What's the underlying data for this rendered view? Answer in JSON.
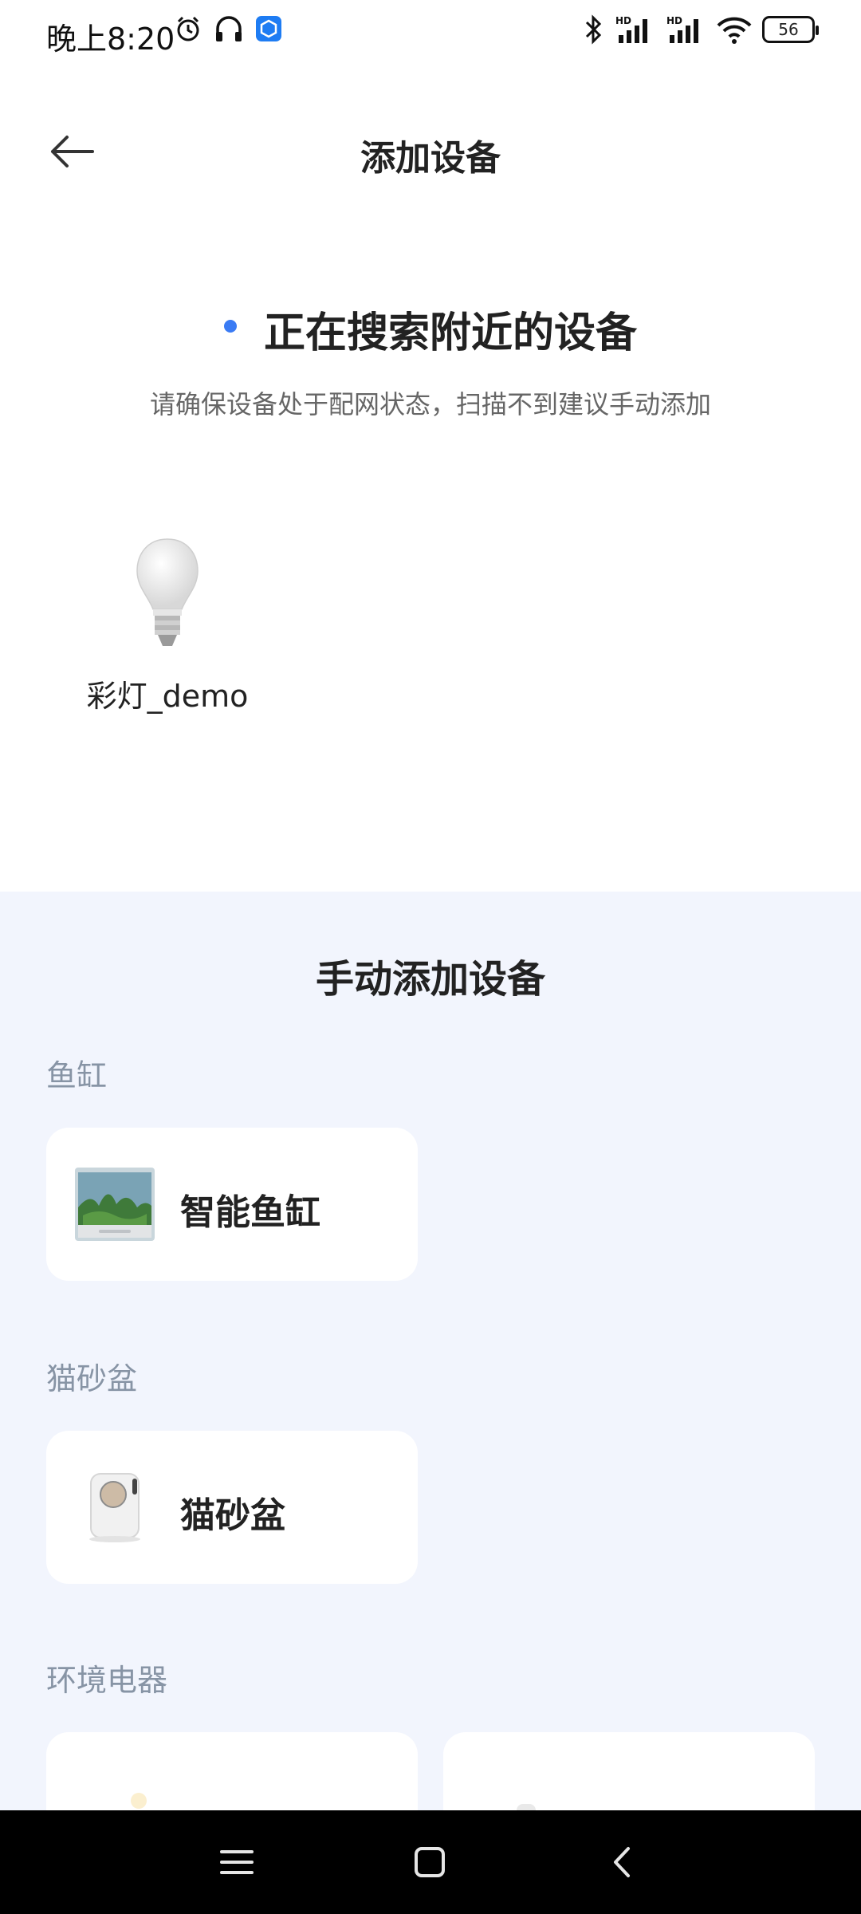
{
  "status_bar": {
    "time": "晚上8:20",
    "battery": "56",
    "icons": [
      "alarm-icon",
      "headphones-icon",
      "app-notification-icon",
      "bluetooth-icon",
      "signal-hd-icon",
      "signal-hd-icon",
      "wifi-icon",
      "battery-icon"
    ]
  },
  "header": {
    "title": "添加设备",
    "back_icon": "arrow-left-icon"
  },
  "search": {
    "title": "正在搜索附近的设备",
    "hint": "请确保设备处于配网状态，扫描不到建议手动添加"
  },
  "found_devices": [
    {
      "label": "彩灯_demo",
      "icon": "light-bulb-icon"
    }
  ],
  "manual": {
    "title": "手动添加设备",
    "categories": [
      {
        "name": "鱼缸",
        "items": [
          {
            "label": "智能鱼缸",
            "icon": "fish-tank-icon"
          }
        ]
      },
      {
        "name": "猫砂盆",
        "items": [
          {
            "label": "猫砂盆",
            "icon": "litter-box-icon"
          }
        ]
      },
      {
        "name": "环境电器",
        "items": [
          {
            "label": "",
            "icon": "appliance-icon"
          },
          {
            "label": "",
            "icon": "appliance-icon"
          }
        ]
      }
    ]
  },
  "nav_bar": {
    "icons": [
      "menu-icon",
      "home-icon",
      "back-icon"
    ]
  }
}
